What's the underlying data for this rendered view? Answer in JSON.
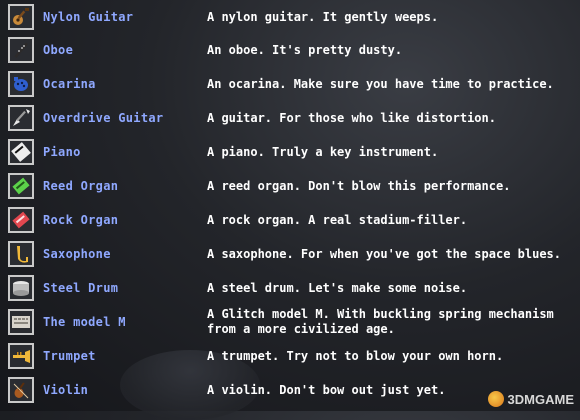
{
  "items": [
    {
      "name": "Nylon Guitar",
      "desc": "A nylon guitar. It gently weeps.",
      "icon": "guitar-icon"
    },
    {
      "name": "Oboe",
      "desc": "An oboe. It's pretty dusty.",
      "icon": "oboe-icon"
    },
    {
      "name": "Ocarina",
      "desc": "An ocarina. Make sure you have time to practice.",
      "icon": "ocarina-icon"
    },
    {
      "name": "Overdrive Guitar",
      "desc": "A guitar. For those who like distortion.",
      "icon": "electric-guitar-icon"
    },
    {
      "name": "Piano",
      "desc": "A piano. Truly a key instrument.",
      "icon": "piano-icon"
    },
    {
      "name": "Reed Organ",
      "desc": "A reed organ. Don't blow this performance.",
      "icon": "reed-organ-icon"
    },
    {
      "name": "Rock Organ",
      "desc": "A rock organ. A real stadium-filler.",
      "icon": "rock-organ-icon"
    },
    {
      "name": "Saxophone",
      "desc": "A saxophone. For when you've got the space blues.",
      "icon": "saxophone-icon"
    },
    {
      "name": "Steel Drum",
      "desc": "A steel drum. Let's make some noise.",
      "icon": "steel-drum-icon"
    },
    {
      "name": "The model M",
      "desc": "A Glitch model M. With buckling spring mechanism from a more civilized age.",
      "icon": "keyboard-icon"
    },
    {
      "name": "Trumpet",
      "desc": "A trumpet. Try not to blow your own horn.",
      "icon": "trumpet-icon"
    },
    {
      "name": "Violin",
      "desc": "A violin. Don't bow out just yet.",
      "icon": "violin-icon"
    }
  ],
  "watermark": "3DMGAME"
}
